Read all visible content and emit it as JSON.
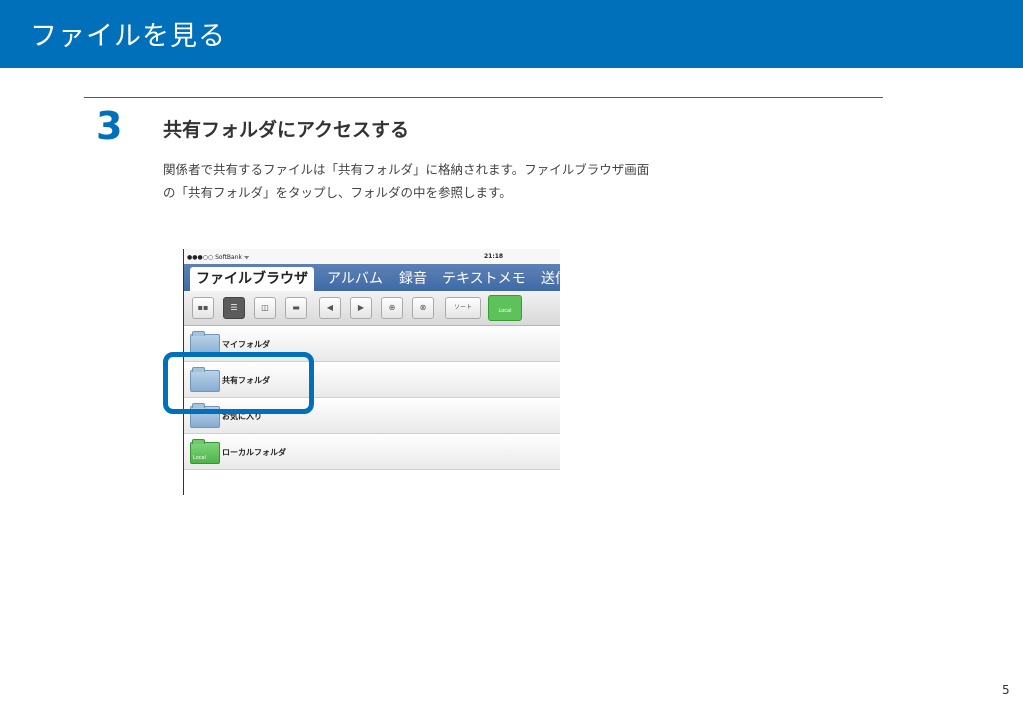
{
  "header": {
    "title": "ファイルを見る"
  },
  "step": {
    "number": "3",
    "title": "共有フォルダにアクセスする",
    "description_line1": "関係者で共有するファイルは「共有フォルダ」に格納されます。ファイルブラウザ画面",
    "description_line2": "の「共有フォルダ」をタップし、フォルダの中を参照します。"
  },
  "screenshot": {
    "status": {
      "carrier": "●●●○○ SoftBank ᯤ",
      "time": "21:18"
    },
    "tabs": [
      "ファイルブラウザ",
      "アルバム",
      "録音",
      "テキストメモ",
      "送信"
    ],
    "toolbar": {
      "sort_label": "ソート",
      "local_label": "Local"
    },
    "rows": [
      {
        "label": "マイフォルダ"
      },
      {
        "label": "共有フォルダ"
      },
      {
        "label": "お気に入り"
      },
      {
        "label": "ローカルフォルダ",
        "icon_text": "Local"
      }
    ]
  },
  "page": {
    "number": "5"
  },
  "colors": {
    "brand": "#0070bb"
  }
}
